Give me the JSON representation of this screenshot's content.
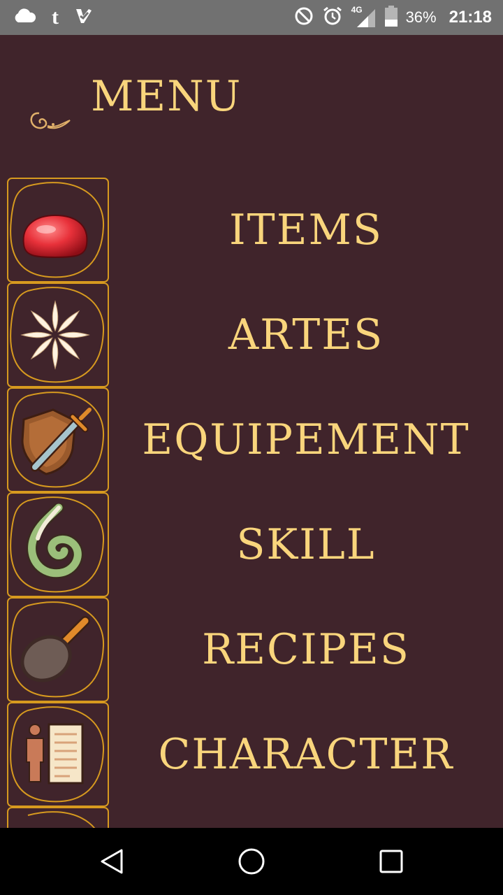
{
  "status_bar": {
    "left_icons": [
      "cloud-icon",
      "tumblr-icon",
      "checkmark-app-icon"
    ],
    "tumblr_glyph": "t",
    "network_label": "4G",
    "battery_percent": "36%",
    "time": "21:18"
  },
  "page": {
    "title": "MENU"
  },
  "menu": {
    "items": [
      {
        "label": "ITEMS",
        "icon": "gel-icon"
      },
      {
        "label": "ARTES",
        "icon": "artes-star-icon"
      },
      {
        "label": "EQUIPEMENT",
        "icon": "sword-shield-icon"
      },
      {
        "label": "SKILL",
        "icon": "swirl-icon"
      },
      {
        "label": "RECIPES",
        "icon": "frying-pan-icon"
      },
      {
        "label": "CHARACTER",
        "icon": "character-sheet-icon"
      }
    ]
  },
  "nav_bar": {
    "buttons": [
      "back-button",
      "home-button",
      "recents-button"
    ]
  },
  "colors": {
    "background": "#40242b",
    "accent_gold": "#f9d57c",
    "frame_gold": "#d79a1f",
    "status_bar": "#717171"
  }
}
